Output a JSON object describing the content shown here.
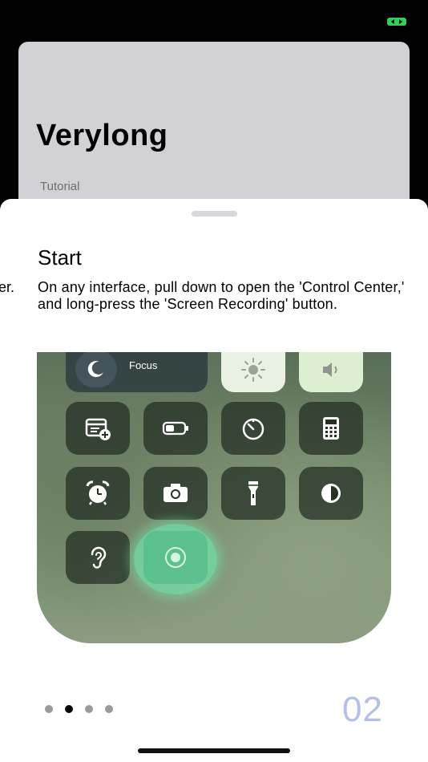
{
  "background": {
    "title": "Verylong",
    "subtitle": "Tutorial"
  },
  "sheet": {
    "peek_text": "er.",
    "step_title": "Start",
    "step_description": "On any interface, pull down to open the 'Control Center,' and long-press the 'Screen Recording' button.",
    "page_number": "02",
    "pagination": {
      "total": 4,
      "active_index": 1
    }
  },
  "control_center": {
    "focus_label": "Focus",
    "tiles": [
      "calendar-add-icon",
      "battery-icon",
      "timer-icon",
      "calculator-icon",
      "alarm-icon",
      "camera-icon",
      "flashlight-icon",
      "dark-mode-icon",
      "hearing-icon",
      "screen-recording-icon"
    ]
  },
  "colors": {
    "record_highlight": "#70e2aa",
    "page_number": "#b4bfe8",
    "status_icon": "#30d158"
  }
}
